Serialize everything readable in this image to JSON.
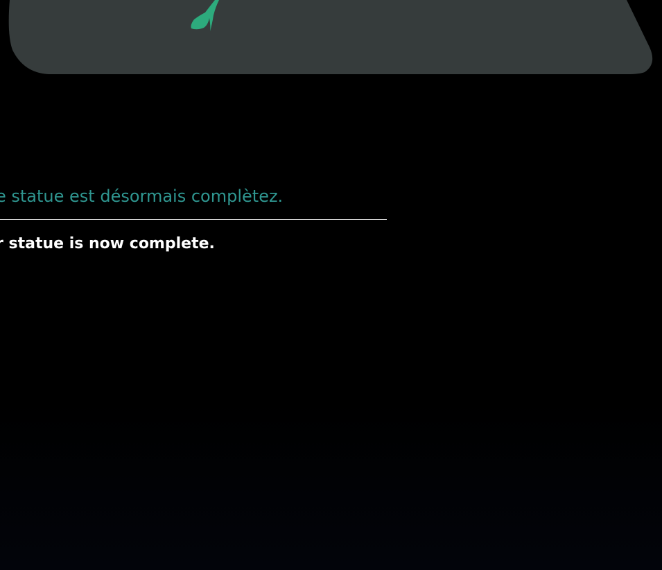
{
  "card": {
    "fill_color": "#363c3c",
    "check_color": "#2dab7d",
    "icon": "checkmark-icon"
  },
  "prompt": {
    "french": "e statue est désormais complètez.",
    "english": "r statue is now complete.",
    "french_color": "#2f9690",
    "english_color": "#ffffff"
  }
}
